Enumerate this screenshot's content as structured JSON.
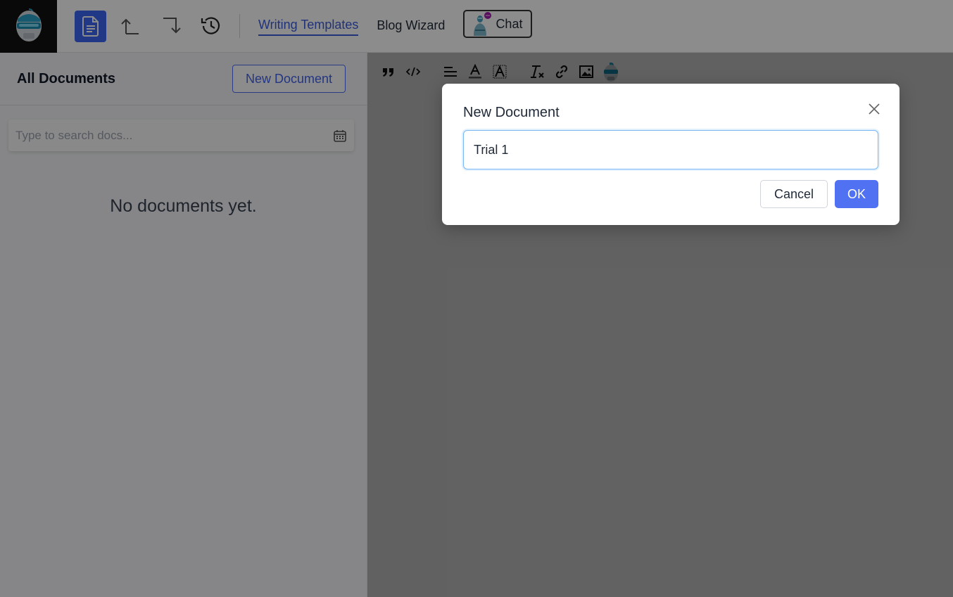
{
  "topbar": {
    "logo_icon": "robot-helmet-logo",
    "actions": [
      {
        "icon": "document-icon",
        "label": "Documents"
      },
      {
        "icon": "undo-icon",
        "label": "Undo"
      },
      {
        "icon": "redo-icon",
        "label": "Redo"
      },
      {
        "icon": "history-icon",
        "label": "History"
      }
    ],
    "nav": [
      {
        "label": "Writing Templates",
        "active": true
      },
      {
        "label": "Blog Wizard",
        "active": false
      }
    ],
    "chat_label": "Chat"
  },
  "sidebar": {
    "title": "All Documents",
    "new_button": "New Document",
    "search_placeholder": "Type to search docs...",
    "search_value": "",
    "empty_message": "No documents yet."
  },
  "editor": {
    "toolbar": [
      {
        "icon": "quote-icon"
      },
      {
        "icon": "code-icon"
      },
      {
        "icon": "align-icon"
      },
      {
        "icon": "font-color-icon"
      },
      {
        "icon": "highlight-icon"
      },
      {
        "icon": "clear-format-icon"
      },
      {
        "icon": "link-icon"
      },
      {
        "icon": "image-icon"
      },
      {
        "icon": "ai-assistant-icon"
      }
    ]
  },
  "modal": {
    "title": "New Document",
    "input_value": "Trial 1",
    "cancel_label": "Cancel",
    "ok_label": "OK"
  },
  "colors": {
    "accent": "#3b66f5",
    "ok_button": "#5071f1",
    "link_active": "#3b5bdb"
  }
}
